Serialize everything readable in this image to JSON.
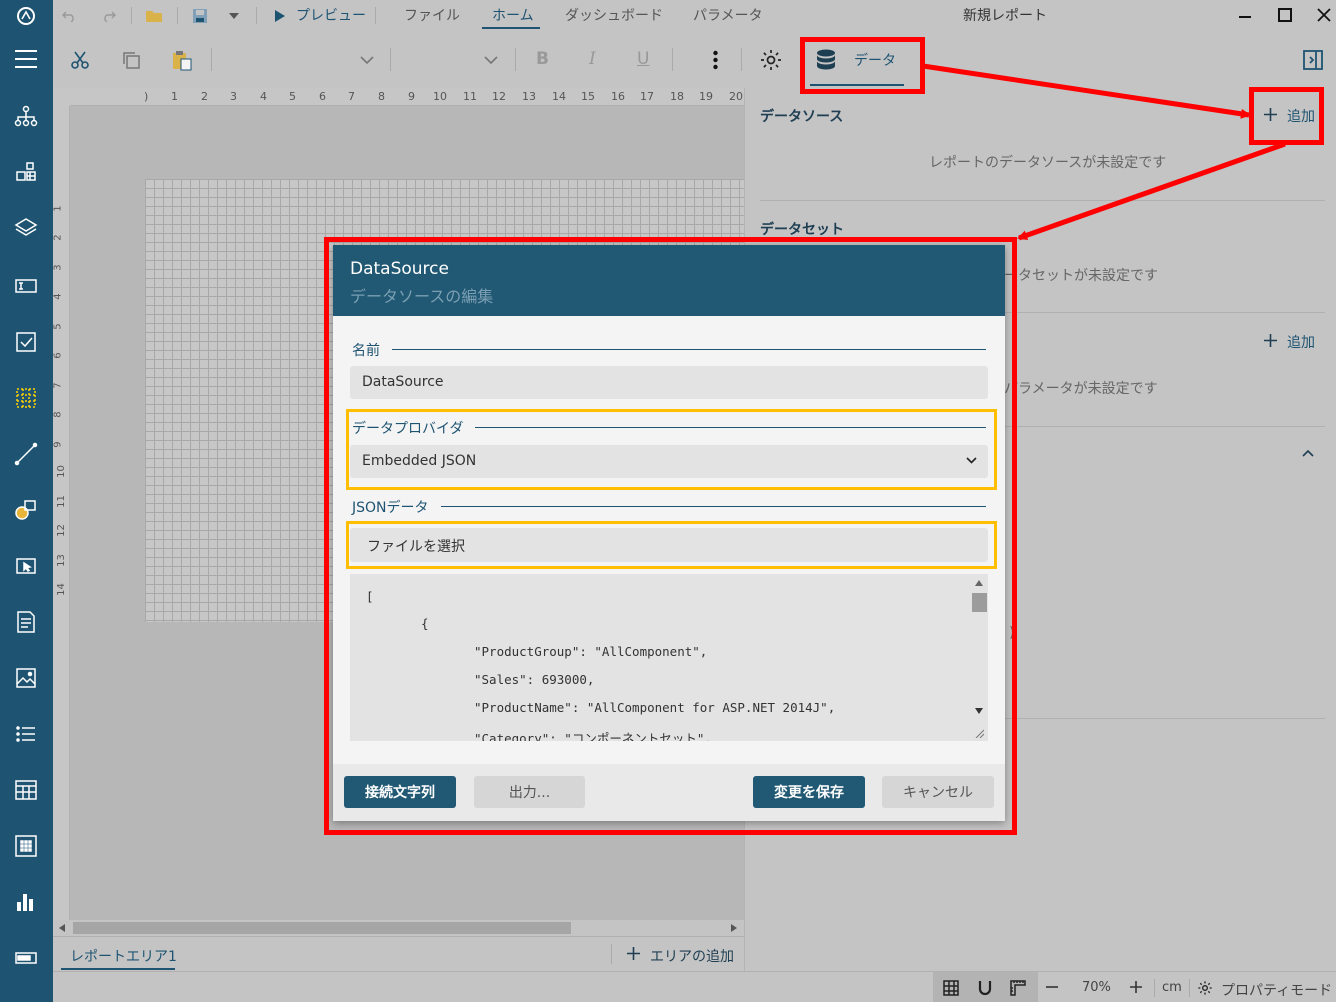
{
  "window": {
    "title": "新規レポート"
  },
  "menu": {
    "preview": "プレビュー",
    "file": "ファイル",
    "home": "ホーム",
    "dashboard": "ダッシュボード",
    "parameters": "パラメータ"
  },
  "toolbar": {
    "bold": "B",
    "italic": "I",
    "underline": "U",
    "data_tab": "データ"
  },
  "ruler": {
    "top": [
      "1",
      "2",
      "3",
      "4",
      "5",
      "6",
      "7",
      "8",
      "9",
      "10",
      "11",
      "12",
      "13",
      "14",
      "15",
      "16",
      "17",
      "18",
      "19",
      "20"
    ],
    "left": [
      "1",
      "2",
      "3",
      "4",
      "5",
      "6",
      "7",
      "8",
      "9",
      "10",
      "11",
      "12",
      "13",
      "14"
    ]
  },
  "panel": {
    "datasource_title": "データソース",
    "datasource_add": "追加",
    "datasource_empty": "レポートのデータソースが未設定です",
    "dataset_title": "データセット",
    "dataset_empty": "ータセットが未設定です",
    "parameter_add": "追加",
    "parameter_empty": "パラメータが未設定です",
    "partial_text": ")"
  },
  "dialog": {
    "title": "DataSource",
    "subtitle": "データソースの編集",
    "name_label": "名前",
    "name_value": "DataSource",
    "provider_label": "データプロバイダ",
    "provider_value": "Embedded JSON",
    "json_label": "JSONデータ",
    "select_file": "ファイルを選択",
    "json_lines": [
      "[",
      "{",
      "\"ProductGroup\": \"AllComponent\",",
      "\"Sales\": 693000,",
      "\"ProductName\": \"AllComponent for ASP.NET 2014J\",",
      "\"Category\": \"コンポーネントセット\","
    ],
    "btn_connection": "接続文字列",
    "btn_output": "出力...",
    "btn_save": "変更を保存",
    "btn_cancel": "キャンセル"
  },
  "bottom": {
    "area_tab": "レポートエリア1",
    "add_area": "エリアの追加"
  },
  "status": {
    "zoom": "70%",
    "unit": "cm",
    "property_mode": "プロパティモード"
  },
  "colors": {
    "accent": "#1e5472",
    "annotation_red": "#ff0000",
    "annotation_yellow": "#ffbf00"
  }
}
